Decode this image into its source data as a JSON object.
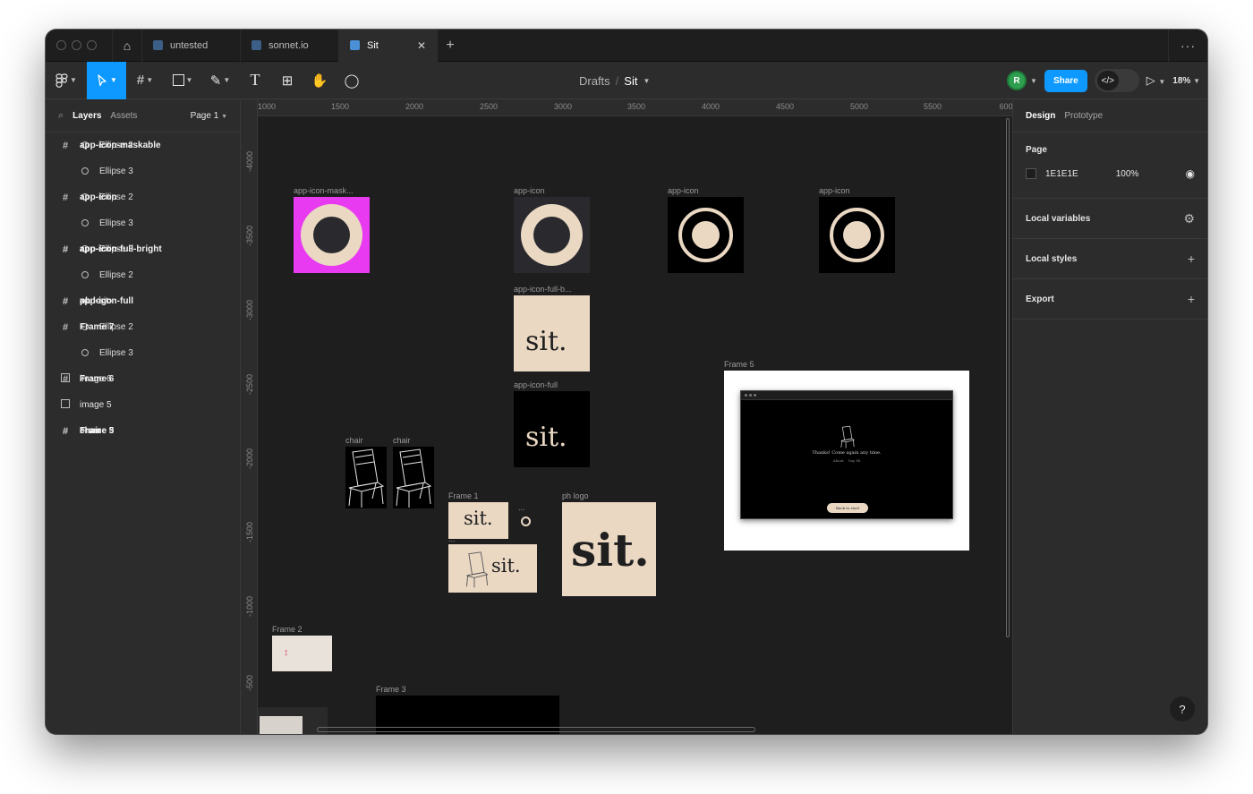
{
  "tabs": [
    {
      "label": "untested"
    },
    {
      "label": "sonnet.io"
    },
    {
      "label": "Sit"
    }
  ],
  "toolbar": {
    "breadcrumb_parent": "Drafts",
    "breadcrumb_sep": "/",
    "breadcrumb_current": "Sit",
    "avatar_initial": "R",
    "share_label": "Share",
    "zoom": "18%"
  },
  "left_panel": {
    "tab_layers": "Layers",
    "tab_assets": "Assets",
    "page_select": "Page 1",
    "layers": [
      {
        "label": "app-icon-maskable",
        "kind": "frame"
      },
      {
        "label": "Ellipse 2",
        "kind": "ellipse"
      },
      {
        "label": "Ellipse 3",
        "kind": "ellipse"
      },
      {
        "label": "app-icon",
        "kind": "frame"
      },
      {
        "label": "Ellipse 2",
        "kind": "ellipse"
      },
      {
        "label": "Ellipse 3",
        "kind": "ellipse"
      },
      {
        "label": "app-icon-full-bright",
        "kind": "frame"
      },
      {
        "label": "app-icon",
        "kind": "frame"
      },
      {
        "label": "app-icon",
        "kind": "frame"
      },
      {
        "label": "Ellipse 3",
        "kind": "ellipse"
      },
      {
        "label": "Ellipse 2",
        "kind": "ellipse"
      },
      {
        "label": "app-icon-full",
        "kind": "frame"
      },
      {
        "label": "ph logo",
        "kind": "frame"
      },
      {
        "label": "sit.",
        "kind": "vector"
      },
      {
        "label": "Frame 7",
        "kind": "frame"
      },
      {
        "label": "Ellipse 2",
        "kind": "ellipse"
      },
      {
        "label": "Ellipse 3",
        "kind": "ellipse"
      },
      {
        "label": "Frame 6",
        "kind": "frame"
      },
      {
        "label": "image 6",
        "kind": "image"
      },
      {
        "label": "image 5",
        "kind": "image"
      },
      {
        "label": "Frame 5",
        "kind": "frame"
      },
      {
        "label": "Frame 3",
        "kind": "frame"
      },
      {
        "label": "chair",
        "kind": "frame"
      }
    ]
  },
  "right_panel": {
    "tab_design": "Design",
    "tab_prototype": "Prototype",
    "page_title": "Page",
    "page_color_hex": "1E1E1E",
    "page_opacity": "100%",
    "local_variables": "Local variables",
    "local_styles": "Local styles",
    "export": "Export",
    "help": "?"
  },
  "rulers": {
    "top": [
      "1000",
      "1500",
      "2000",
      "2500",
      "3000",
      "3500",
      "4000",
      "4500",
      "5000",
      "5500",
      "600"
    ],
    "left": [
      "-4000",
      "-3500",
      "-3000",
      "-2500",
      "-2000",
      "-1500",
      "-1000",
      "-500"
    ]
  },
  "canvas": {
    "labels": {
      "maskable": "app-icon-mask...",
      "app_icon_1": "app-icon",
      "app_icon_2": "app-icon",
      "app_icon_3": "app-icon",
      "full_bright": "app-icon-full-b...",
      "full": "app-icon-full",
      "chair_1": "chair",
      "chair_2": "chair",
      "frame1": "Frame 1",
      "small_dots": "...",
      "frame7": "...",
      "ph_logo": "ph logo",
      "frame5": "Frame 5",
      "frame2": "Frame 2",
      "frame3": "Frame 3"
    },
    "logo_text": "sit.",
    "mini_screen": {
      "message": "Thanks! Come again any time.",
      "link_1": "About",
      "link_2": "Say Hi",
      "button": "Back to start"
    }
  },
  "colors": {
    "accent": "#0d99ff",
    "cream": "#ead8c3",
    "magenta": "#e83af0",
    "dark": "#2a2a2e"
  }
}
